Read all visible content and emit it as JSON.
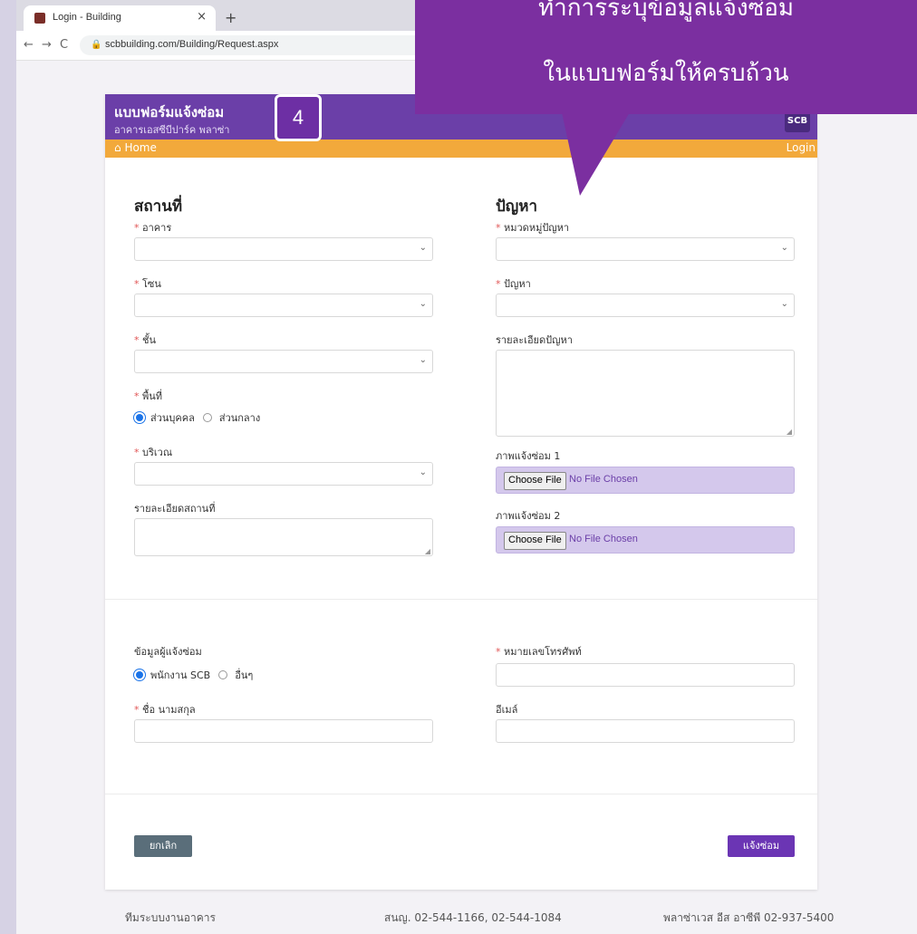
{
  "browser": {
    "tab_title": "Login - Building",
    "tab_close": "×",
    "new_tab": "+",
    "url": "scbbuilding.com/Building/Request.aspx"
  },
  "header": {
    "title": "แบบฟอร์มแจ้งซ่อม",
    "subtitle": "อาคารเอสซีบีปาร์ค พลาซ่า",
    "logo_text": "SCB"
  },
  "nav": {
    "home": "Home",
    "login": "Login"
  },
  "location": {
    "section_title": "สถานที่",
    "building_label": "อาคาร",
    "zone_label": "โซน",
    "floor_label": "ชั้น",
    "area_label": "พื้นที่",
    "area_options": [
      "ส่วนบุคคล",
      "ส่วนกลาง"
    ],
    "area_selected": "ส่วนบุคคล",
    "spot_label": "บริเวณ",
    "details_label": "รายละเอียดสถานที่"
  },
  "problem": {
    "section_title": "ปัญหา",
    "category_label": "หมวดหมู่ปัญหา",
    "problem_label": "ปัญหา",
    "details_label": "รายละเอียดปัญหา",
    "image1_label": "ภาพแจ้งซ่อม 1",
    "image2_label": "ภาพแจ้งซ่อม 2",
    "choose_file": "Choose File",
    "no_file": "No File Chosen"
  },
  "reporter": {
    "label": "ข้อมูลผู้แจ้งซ่อม",
    "options": [
      "พนักงาน SCB",
      "อื่นๆ"
    ],
    "selected": "พนักงาน SCB",
    "name_label": "ชื่อ นามสกุล",
    "phone_label": "หมายเลขโทรศัพท์",
    "email_label": "อีเมล์"
  },
  "actions": {
    "cancel": "ยกเลิก",
    "submit": "แจ้งซ่อม"
  },
  "footer": {
    "left": "ทีมระบบงานอาคาร",
    "center": "สนญ. 02-544-1166, 02-544-1084",
    "right": "พลาซ่าเวส อีส อาซีพี 02-937-5400"
  },
  "overlay": {
    "step_number": "4",
    "callout_line1": "ทำการระบุข้อมูลแจ้งซ่อม",
    "callout_line2": "ในแบบฟอร์มให้ครบถ้วน"
  },
  "colors": {
    "header_purple": "#6b3fa8",
    "nav_orange": "#f2a93b",
    "callout_purple": "#7b2fa0",
    "required_red": "#e05555"
  }
}
